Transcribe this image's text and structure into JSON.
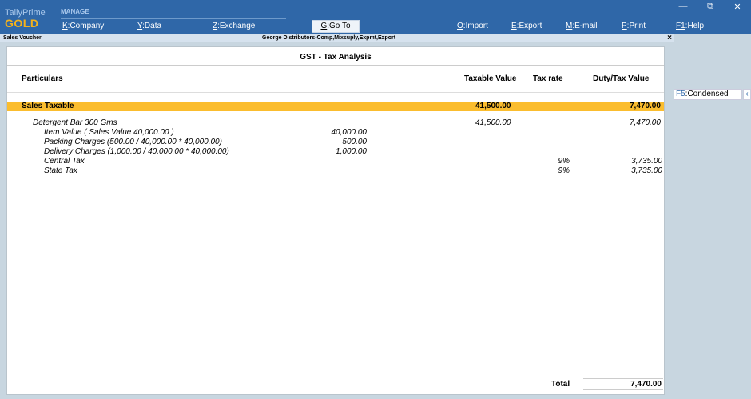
{
  "brand": {
    "name": "TallyPrime",
    "edition": "GOLD"
  },
  "topmenu": {
    "section": "MANAGE",
    "company": {
      "key": "K",
      "label": "Company"
    },
    "data": {
      "key": "Y",
      "label": "Data"
    },
    "exchange": {
      "key": "Z",
      "label": "Exchange"
    },
    "goto": {
      "key": "G",
      "label": "Go To"
    },
    "import": {
      "key": "O",
      "label": "Import"
    },
    "export": {
      "key": "E",
      "label": "Export"
    },
    "email": {
      "key": "M",
      "label": "E-mail"
    },
    "print": {
      "key": "P",
      "label": "Print"
    },
    "help": {
      "key": "F1",
      "label": "Help"
    }
  },
  "window": {
    "minimize": "—",
    "restore": "⧉",
    "close": "✕"
  },
  "titlestrip": {
    "left": "Sales Voucher",
    "center": "George Distributors-Comp,Mixsuply,Expmt,Export",
    "close": "×"
  },
  "report": {
    "title": "GST - Tax Analysis",
    "columns": {
      "particulars": "Particulars",
      "taxable": "Taxable Value",
      "rate": "Tax rate",
      "duty": "Duty/Tax Value"
    },
    "group": {
      "label": "Sales Taxable",
      "taxable": "41,500.00",
      "duty": "7,470.00"
    },
    "item": {
      "name": "Detergent Bar 300 Gms",
      "taxable": "41,500.00",
      "duty": "7,470.00"
    },
    "details": [
      {
        "label": "Item Value ( Sales Value 40,000.00 )",
        "amount": "40,000.00"
      },
      {
        "label": "Packing Charges (500.00 / 40,000.00 * 40,000.00)",
        "amount": "500.00"
      },
      {
        "label": "Delivery Charges (1,000.00 / 40,000.00 * 40,000.00)",
        "amount": "1,000.00"
      }
    ],
    "taxes": [
      {
        "label": "Central Tax",
        "rate": "9%",
        "value": "3,735.00"
      },
      {
        "label": "State Tax",
        "rate": "9%",
        "value": "3,735.00"
      }
    ],
    "total": {
      "label": "Total",
      "value": "7,470.00"
    }
  },
  "side": {
    "f5": {
      "key": "F5",
      "label": "Condensed"
    },
    "collapse": "‹"
  }
}
